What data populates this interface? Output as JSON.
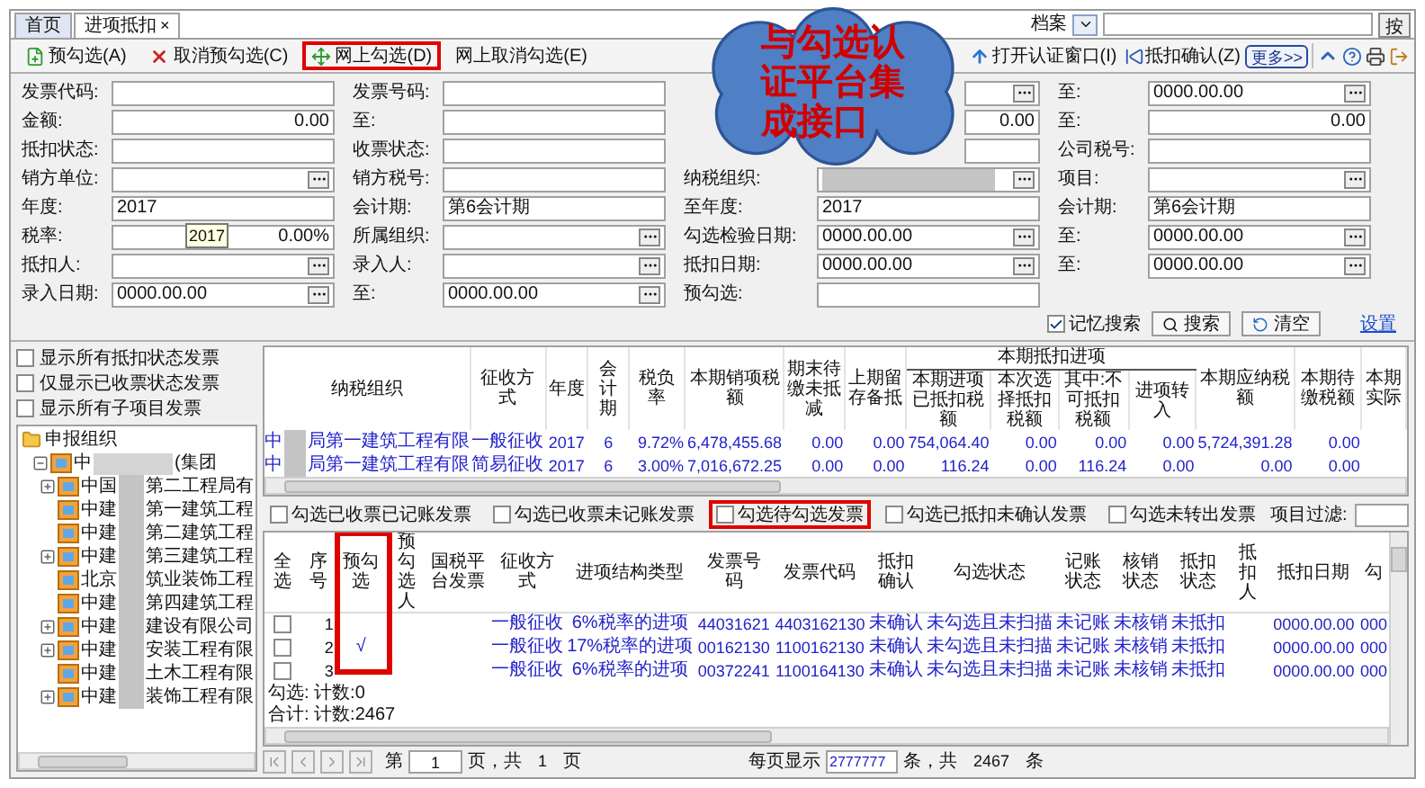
{
  "tabs": [
    {
      "label": "首页",
      "selected": false
    },
    {
      "label": "进项抵扣",
      "selected": true,
      "close": "×"
    }
  ],
  "archive": {
    "label": "档案",
    "cut_button": "按"
  },
  "toolbar": [
    {
      "label": "预勾选(A)",
      "highlighted": false
    },
    {
      "label": "取消预勾选(C)",
      "highlighted": false
    },
    {
      "label": "网上勾选(D)",
      "highlighted": true
    },
    {
      "label": "网上取消勾选(E)",
      "highlighted": false
    }
  ],
  "toolbar_right": [
    {
      "label": "打开认证窗口(I)",
      "kind": "button"
    },
    {
      "label": "抵扣确认(Z)",
      "kind": "button"
    },
    {
      "label": "更多>>",
      "kind": "more"
    }
  ],
  "callout": {
    "lines": [
      "与勾选认",
      "证平台集",
      "成接口"
    ]
  },
  "form": [
    [
      {
        "label": "发票代码:",
        "kind": "text",
        "picker": false
      },
      {
        "label": "发票号码:",
        "kind": "text",
        "picker": false
      },
      {
        "kind": "text",
        "picker": true
      },
      {
        "label": "至:",
        "value": "0000.00.00",
        "kind": "text",
        "picker": true
      }
    ],
    [
      {
        "label": "金额:",
        "value": "0.00",
        "kind": "number",
        "picker": false
      },
      {
        "label": "至:",
        "kind": "text",
        "picker": false
      },
      {
        "value": "0.00",
        "kind": "number",
        "picker": false
      },
      {
        "label": "至:",
        "value": "0.00",
        "kind": "number",
        "picker": false
      }
    ],
    [
      {
        "label": "抵扣状态:",
        "kind": "text",
        "picker": false
      },
      {
        "label": "收票状态:",
        "kind": "text",
        "picker": false
      },
      {
        "kind": "text",
        "picker": false
      },
      {
        "label": "公司税号:",
        "kind": "text",
        "picker": false
      }
    ],
    [
      {
        "label": "销方单位:",
        "kind": "text",
        "picker": true
      },
      {
        "label": "销方税号:",
        "kind": "text",
        "picker": false
      },
      {
        "label": "纳税组织:",
        "kind": "redacted",
        "picker": true
      },
      {
        "label": "项目:",
        "kind": "text",
        "picker": true
      }
    ],
    [
      {
        "label": "年度:",
        "value": "2017",
        "kind": "text",
        "picker": false
      },
      {
        "label": "会计期:",
        "value": "第6会计期",
        "kind": "text",
        "picker": false
      },
      {
        "label": "至年度:",
        "value": "2017",
        "kind": "text",
        "picker": false
      },
      {
        "label": "会计期:",
        "value": "第6会计期",
        "kind": "text",
        "picker": false
      }
    ],
    [
      {
        "label": "税率:",
        "value": "0.00%",
        "kind": "number",
        "picker": false,
        "tooltip": "2017"
      },
      {
        "label": "所属组织:",
        "kind": "text",
        "picker": true
      },
      {
        "label": "勾选检验日期:",
        "value": "0000.00.00",
        "kind": "text",
        "picker": true
      },
      {
        "label": "至:",
        "value": "0000.00.00",
        "kind": "text",
        "picker": true
      }
    ],
    [
      {
        "label": "抵扣人:",
        "kind": "text",
        "picker": true
      },
      {
        "label": "录入人:",
        "kind": "text",
        "picker": true
      },
      {
        "label": "抵扣日期:",
        "value": "0000.00.00",
        "kind": "text",
        "picker": true
      },
      {
        "label": "至:",
        "value": "0000.00.00",
        "kind": "text",
        "picker": true
      }
    ],
    [
      {
        "label": "录入日期:",
        "value": "0000.00.00",
        "kind": "text",
        "picker": true
      },
      {
        "label": "至:",
        "value": "0000.00.00",
        "kind": "text",
        "picker": true
      },
      {
        "label": "预勾选:",
        "kind": "text",
        "picker": false
      }
    ]
  ],
  "search_bar": {
    "remember": {
      "label": "记忆搜索",
      "checked": true
    },
    "search": "搜索",
    "clear": "清空",
    "settings": "设置"
  },
  "left_filters": [
    {
      "label": "显示所有抵扣状态发票",
      "checked": false
    },
    {
      "label": "仅显示已收票状态发票",
      "checked": false
    },
    {
      "label": "显示所有子项目发票",
      "checked": false
    }
  ],
  "tree": {
    "label": "申报组织",
    "children": [
      {
        "prefix": "中",
        "suffix": "(集团",
        "expanded": true,
        "children": [
          {
            "prefix": "中国",
            "suffix": "第二工程局有",
            "expandable": true
          },
          {
            "prefix": "中建",
            "suffix": "第一建筑工程",
            "expandable": false
          },
          {
            "prefix": "中建",
            "suffix": "第二建筑工程",
            "expandable": false
          },
          {
            "prefix": "中建",
            "suffix": "第三建筑工程",
            "expandable": true
          },
          {
            "prefix": "北京",
            "suffix": "筑业装饰工程",
            "expandable": false
          },
          {
            "prefix": "中建",
            "suffix": "第四建筑工程",
            "expandable": false
          },
          {
            "prefix": "中建",
            "suffix": "建设有限公司",
            "expandable": true
          },
          {
            "prefix": "中建",
            "suffix": "安装工程有限",
            "expandable": true
          },
          {
            "prefix": "中建",
            "suffix": "土木工程有限",
            "expandable": false
          },
          {
            "prefix": "中建",
            "suffix": "装饰工程有限",
            "expandable": true
          }
        ]
      }
    ]
  },
  "summary_table": {
    "columns": [
      {
        "label": "纳税组织"
      },
      {
        "label": "征收方式"
      },
      {
        "label": "年度"
      },
      {
        "label": "会计期"
      },
      {
        "label": "税负率"
      },
      {
        "label": "本期销项税额"
      },
      {
        "label": "期末待缴未抵减"
      },
      {
        "label": "上期留存备抵"
      },
      {
        "label": "本期抵扣进项",
        "colspan": 4,
        "children": [
          {
            "label": "本期进项已抵扣税额"
          },
          {
            "label": "本次选择抵扣税额"
          },
          {
            "label": "其中:不可抵扣税额"
          },
          {
            "label": "进项转入"
          }
        ]
      },
      {
        "label": "本期应纳税额"
      },
      {
        "label": "本期待缴税额"
      },
      {
        "label": "本期实际"
      }
    ],
    "rows": [
      {
        "cells": [
          {
            "prefix": "中",
            "suffix": "局第一建筑工程有限"
          },
          "一般征收",
          "2017",
          "6",
          "9.72%",
          "6,478,455.68",
          "0.00",
          "0.00",
          "754,064.40",
          "0.00",
          "0.00",
          "0.00",
          "5,724,391.28",
          "0.00",
          ""
        ]
      },
      {
        "cells": [
          {
            "prefix": "中",
            "suffix": "局第一建筑工程有限"
          },
          "简易征收",
          "2017",
          "6",
          "3.00%",
          "7,016,672.25",
          "0.00",
          "0.00",
          "116.24",
          "0.00",
          "116.24",
          "0.00",
          "0.00",
          "0.00",
          ""
        ]
      }
    ]
  },
  "bottom_filters": [
    {
      "label": "勾选已收票已记账发票",
      "checked": false,
      "highlighted": false
    },
    {
      "label": "勾选已收票未记账发票",
      "checked": false,
      "highlighted": false
    },
    {
      "label": "勾选待勾选发票",
      "checked": false,
      "highlighted": true
    },
    {
      "label": "勾选已抵扣未确认发票",
      "checked": false,
      "highlighted": false
    },
    {
      "label": "勾选未转出发票",
      "checked": false,
      "highlighted": false
    }
  ],
  "project_filter": {
    "label": "项目过滤:"
  },
  "invoice_table": {
    "columns": [
      {
        "label": "全选",
        "highlighted": false
      },
      {
        "label": "序号",
        "highlighted": false
      },
      {
        "label": "预勾选",
        "highlighted": true
      },
      {
        "label": "预勾选人",
        "highlighted": false
      },
      {
        "label": "国税平台发票",
        "highlighted": false
      },
      {
        "label": "征收方式",
        "highlighted": false
      },
      {
        "label": "进项结构类型",
        "highlighted": false
      },
      {
        "label": "发票号码",
        "highlighted": false
      },
      {
        "label": "发票代码",
        "highlighted": false
      },
      {
        "label": "抵扣确认",
        "highlighted": false
      },
      {
        "label": "勾选状态",
        "highlighted": false
      },
      {
        "label": "记账状态",
        "highlighted": false
      },
      {
        "label": "核销状态",
        "highlighted": false
      },
      {
        "label": "抵扣状态",
        "highlighted": false
      },
      {
        "label": "抵扣人",
        "highlighted": false
      },
      {
        "label": "抵扣日期",
        "highlighted": false
      },
      {
        "label": "勾",
        "highlighted": false
      }
    ],
    "rows": [
      {
        "cells": [
          {
            "checked": false
          },
          "1",
          "",
          "",
          "",
          "一般征收",
          "6%税率的进项",
          "44031621",
          "4403162130",
          "未确认",
          "未勾选且未扫描",
          "未记账",
          "未核销",
          "未抵扣",
          "",
          "0000.00.00",
          "000"
        ]
      },
      {
        "cells": [
          {
            "checked": false
          },
          "2",
          "√",
          "",
          "",
          "一般征收",
          "17%税率的进项",
          "00162130",
          "1100162130",
          "未确认",
          "未勾选且未扫描",
          "未记账",
          "未核销",
          "未抵扣",
          "",
          "0000.00.00",
          "000"
        ]
      },
      {
        "cells": [
          {
            "checked": false
          },
          "3",
          "",
          "",
          "",
          "一般征收",
          "6%税率的进项",
          "00372241",
          "1100164130",
          "未确认",
          "未勾选且未扫描",
          "未记账",
          "未核销",
          "未抵扣",
          "",
          "0000.00.00",
          "000"
        ]
      }
    ]
  },
  "totals": [
    "勾选: 计数:0",
    "合计: 计数:2467"
  ],
  "pager": {
    "page_label": "第",
    "page": "1",
    "pages_label": "页，共",
    "pages": "1",
    "pages_suffix": "页",
    "per_page_label": "每页显示",
    "per_page": "2777777",
    "total_label": "条，共",
    "total": "2467",
    "total_suffix": "条"
  }
}
